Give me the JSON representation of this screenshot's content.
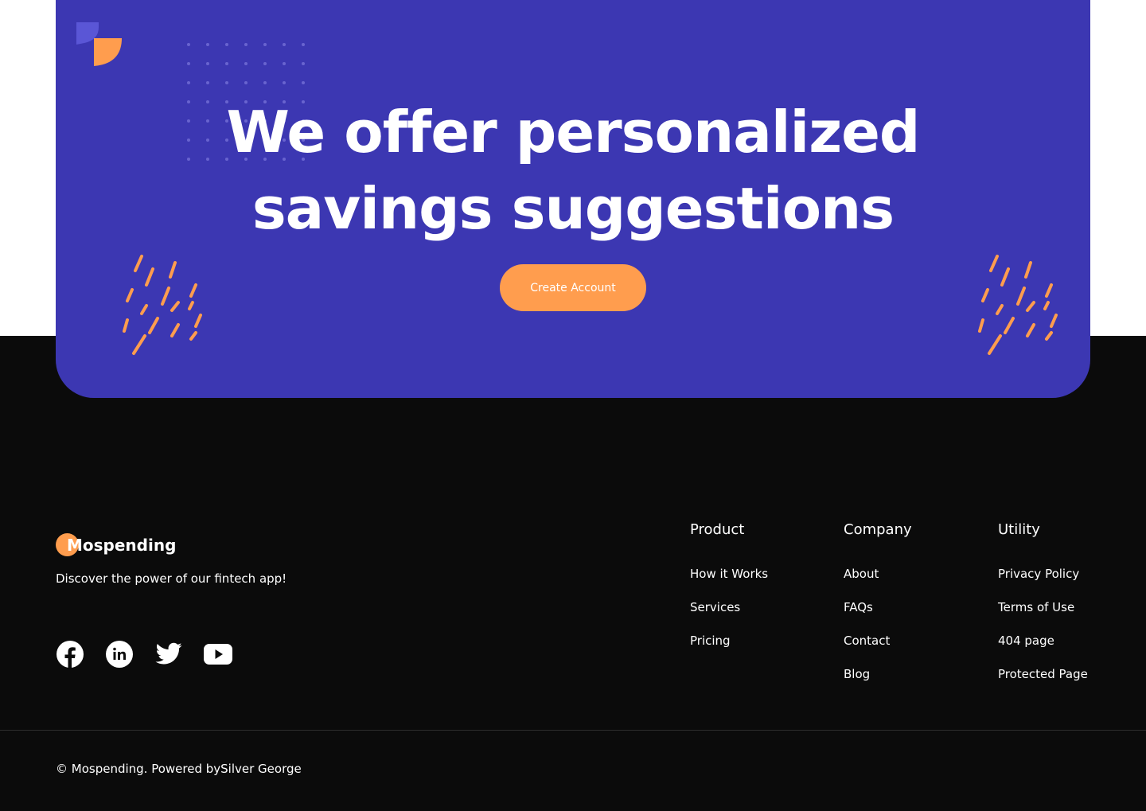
{
  "cta": {
    "title_line1": "We offer personalized",
    "title_line2": "savings suggestions",
    "button_label": "Create Account"
  },
  "footer": {
    "brand_name": "Mospending",
    "tagline": "Discover the power of our fintech app!",
    "socials": [
      "facebook-icon",
      "linkedin-icon",
      "twitter-icon",
      "youtube-icon"
    ],
    "columns": [
      {
        "title": "Product",
        "links": [
          "How it Works",
          "Services",
          "Pricing"
        ]
      },
      {
        "title": "Company",
        "links": [
          "About",
          "FAQs",
          "Contact",
          "Blog"
        ]
      },
      {
        "title": "Utility",
        "links": [
          "Privacy Policy",
          "Terms of Use",
          "404 page",
          "Protected Page"
        ]
      }
    ],
    "copyright": "© Mospending. Powered bySilver George"
  },
  "colors": {
    "card": "#3c37b2",
    "accent": "#ff9d4e",
    "footer_bg": "#0b0b0b"
  }
}
